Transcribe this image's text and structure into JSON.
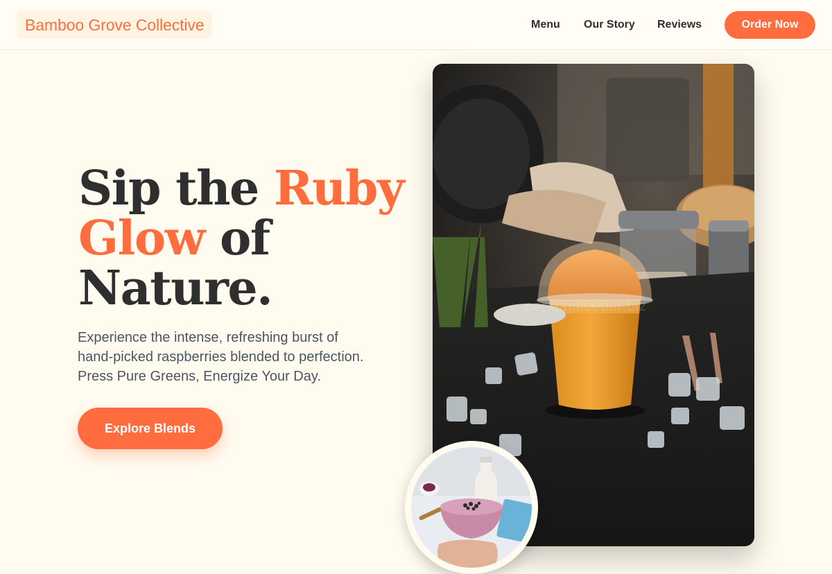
{
  "header": {
    "brand": "Bamboo Grove Collective",
    "nav": {
      "menu": "Menu",
      "our_story": "Our Story",
      "reviews": "Reviews"
    },
    "cta": "Order Now"
  },
  "hero": {
    "title": {
      "part1": "Sip the ",
      "accent1": "Ruby",
      "accent2": "Glow",
      "part2": " of",
      "part3": "Nature."
    },
    "description": {
      "line1": "Experience the intense, refreshing burst of",
      "line2": "hand-picked raspberries blended to perfection.",
      "line3": "Press Pure Greens, Energize Your Day."
    },
    "button": "Explore Blends"
  },
  "images": {
    "main_alt": "Iced orange smoothie in a domed plastic cup on a dark table with ice cubes",
    "main_watermark": "pandajuicebar.biz",
    "secondary_alt": "Pink smoothie bowl with toppings held in hand"
  },
  "colors": {
    "accent": "#ff6d3f",
    "background": "#fffbef",
    "text": "#2f2f2f",
    "muted": "#4b5563"
  }
}
